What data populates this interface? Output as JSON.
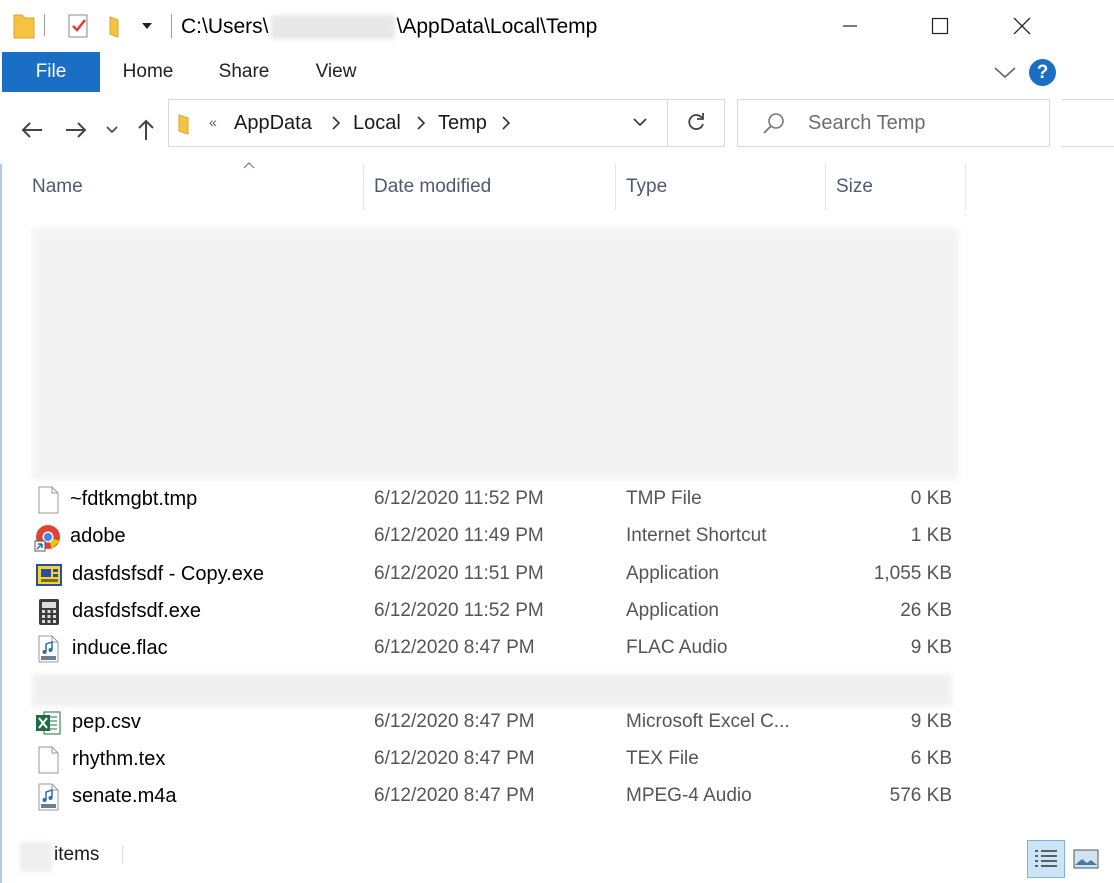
{
  "window": {
    "title_prefix": "C:\\Users\\",
    "title_suffix": "\\AppData\\Local\\Temp"
  },
  "ribbon": {
    "tabs": [
      {
        "label": "File"
      },
      {
        "label": "Home"
      },
      {
        "label": "Share"
      },
      {
        "label": "View"
      }
    ],
    "help_label": "?"
  },
  "nav": {
    "breadcrumb": [
      "AppData",
      "Local",
      "Temp"
    ],
    "overflow_marker": "«",
    "search_placeholder": "Search Temp"
  },
  "columns": {
    "name": "Name",
    "date": "Date modified",
    "type": "Type",
    "size": "Size"
  },
  "files": [
    {
      "name": "~fdtkmgbt.tmp",
      "date": "6/12/2020 11:52 PM",
      "type": "TMP File",
      "size": "0 KB",
      "icon": "blank-file-icon"
    },
    {
      "name": "adobe",
      "date": "6/12/2020 11:49 PM",
      "type": "Internet Shortcut",
      "size": "1 KB",
      "icon": "chrome-shortcut-icon"
    },
    {
      "name": "dasfdsfsdf - Copy.exe",
      "date": "6/12/2020 11:51 PM",
      "type": "Application",
      "size": "1,055 KB",
      "icon": "application-exe-icon"
    },
    {
      "name": "dasfdsfsdf.exe",
      "date": "6/12/2020 11:52 PM",
      "type": "Application",
      "size": "26 KB",
      "icon": "calculator-exe-icon"
    },
    {
      "name": "induce.flac",
      "date": "6/12/2020 8:47 PM",
      "type": "FLAC Audio",
      "size": "9 KB",
      "icon": "audio-file-icon"
    },
    {
      "name": "pep.csv",
      "date": "6/12/2020 8:47 PM",
      "type": "Microsoft Excel C...",
      "size": "9 KB",
      "icon": "excel-file-icon"
    },
    {
      "name": "rhythm.tex",
      "date": "6/12/2020 8:47 PM",
      "type": "TEX File",
      "size": "6 KB",
      "icon": "blank-file-icon"
    },
    {
      "name": "senate.m4a",
      "date": "6/12/2020 8:47 PM",
      "type": "MPEG-4 Audio",
      "size": "576 KB",
      "icon": "audio-file-icon"
    }
  ],
  "status": {
    "items_label": "items"
  },
  "colors": {
    "accent": "#1a6fc4",
    "folder": "#f5c242",
    "header_text": "#4d5a70"
  }
}
